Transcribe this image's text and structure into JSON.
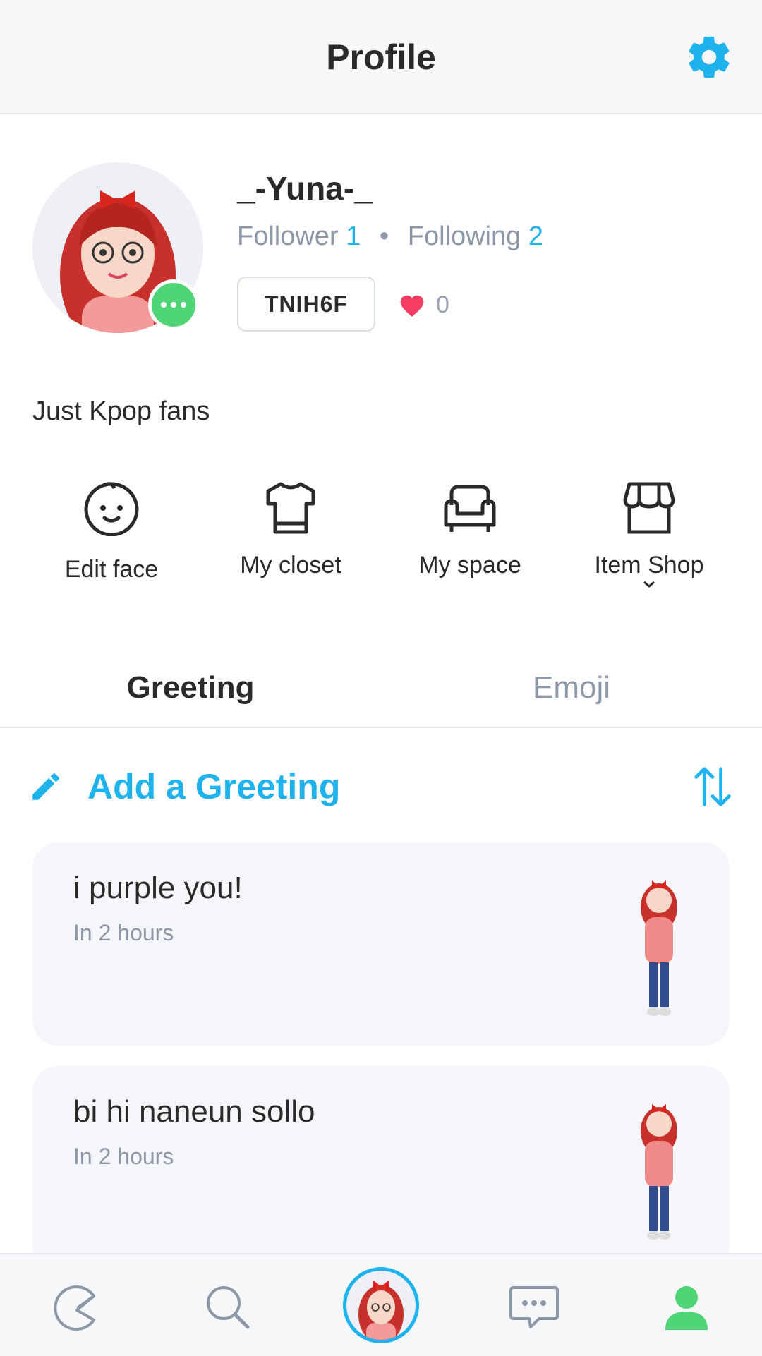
{
  "header": {
    "title": "Profile",
    "settings_icon": "gear-icon"
  },
  "profile": {
    "username": "_-Yuna-_",
    "follower_label": "Follower",
    "follower_count": "1",
    "following_label": "Following",
    "following_count": "2",
    "code": "TNIH6F",
    "likes": "0",
    "bio": "Just Kpop fans"
  },
  "actions": [
    {
      "label": "Edit face",
      "icon": "face-icon"
    },
    {
      "label": "My closet",
      "icon": "shirt-icon"
    },
    {
      "label": "My space",
      "icon": "sofa-icon"
    },
    {
      "label": "Item Shop",
      "icon": "shop-icon"
    }
  ],
  "tabs": [
    {
      "label": "Greeting",
      "active": true
    },
    {
      "label": "Emoji",
      "active": false
    }
  ],
  "greeting": {
    "add_label": "Add a Greeting"
  },
  "greetings": [
    {
      "text": "i purple you!",
      "time": "In 2 hours"
    },
    {
      "text": "bi hi naneun sollo",
      "time": "In 2 hours"
    }
  ],
  "bottom_nav": [
    {
      "icon": "pacman-icon"
    },
    {
      "icon": "search-icon"
    },
    {
      "icon": "avatar-icon"
    },
    {
      "icon": "chat-icon"
    },
    {
      "icon": "person-icon",
      "active": true
    }
  ],
  "colors": {
    "accent": "#1fb3ee",
    "online": "#4fd576",
    "heart": "#f53d63",
    "muted": "#8c98a8"
  }
}
